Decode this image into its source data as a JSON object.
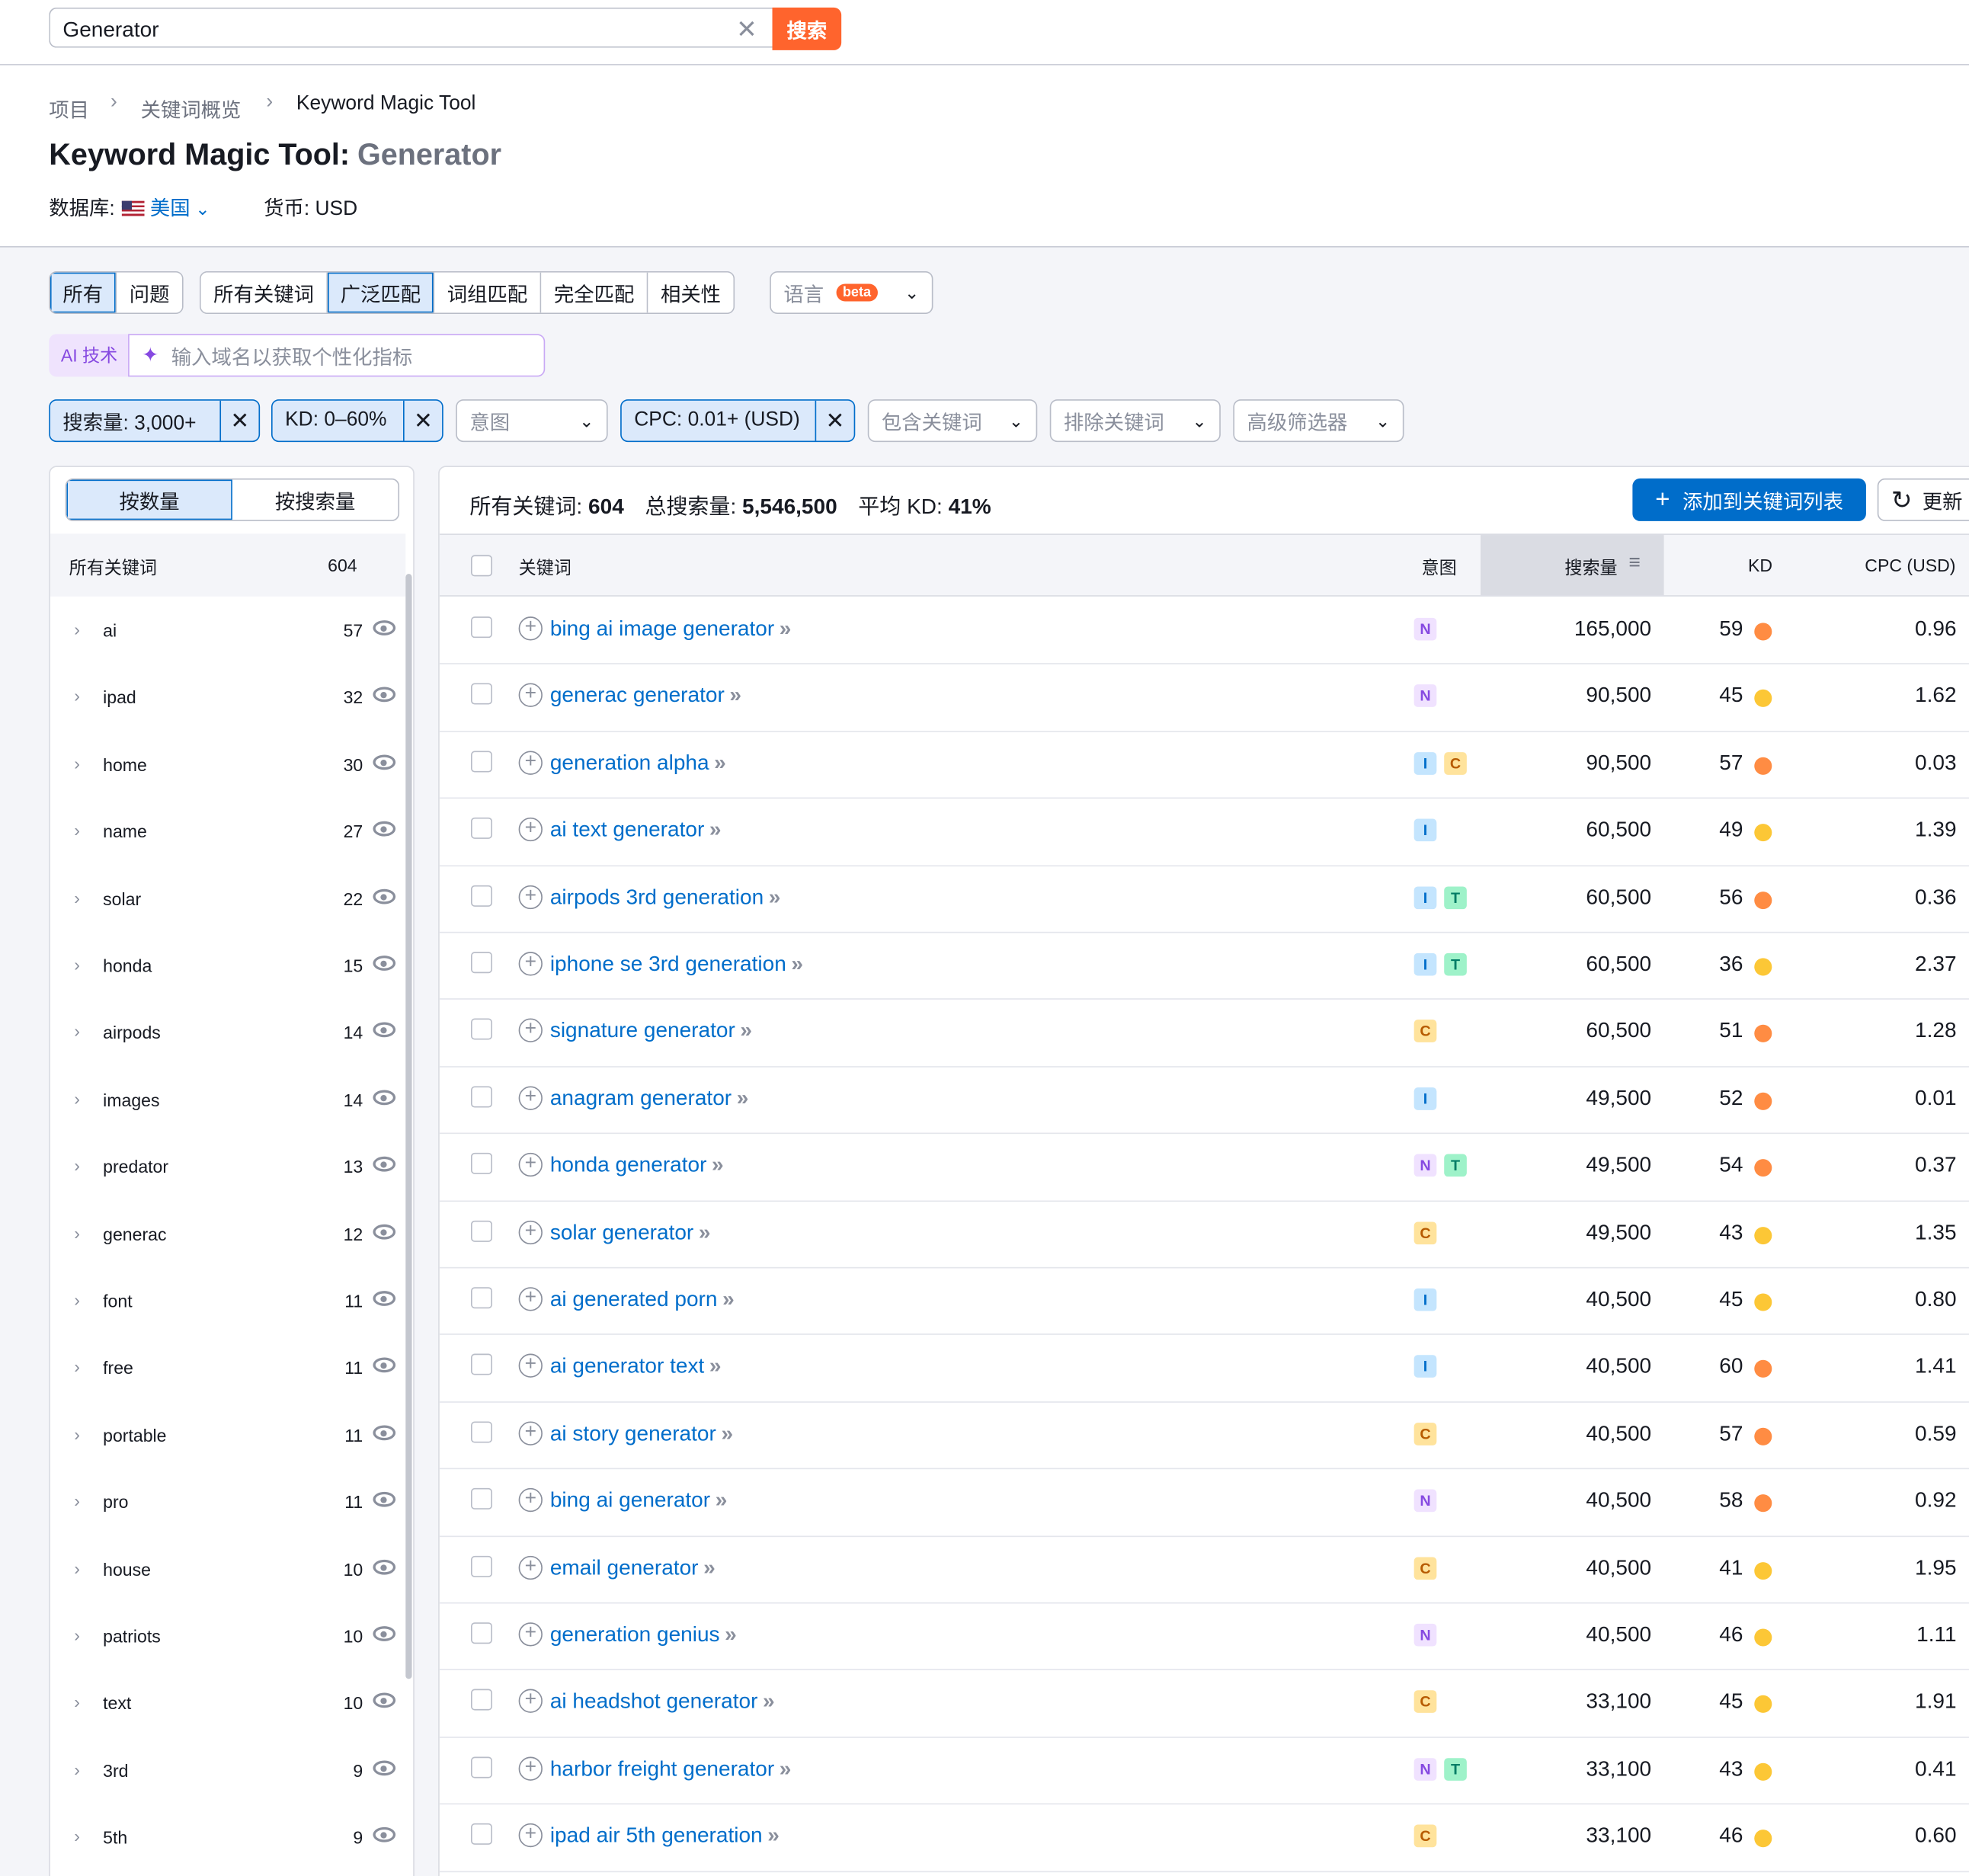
{
  "search": {
    "value": "Generator",
    "button": "搜索",
    "clear_icon": "close-icon"
  },
  "breadcrumb": [
    "项目",
    "关键词概览",
    "Keyword Magic Tool"
  ],
  "title": {
    "tool": "Keyword Magic Tool:",
    "seed": "Generator"
  },
  "database": {
    "label": "数据库:",
    "country": "美国",
    "currency_label": "货币: USD"
  },
  "tabs": {
    "group1": [
      "所有",
      "问题"
    ],
    "group2": [
      "所有关键词",
      "广泛匹配",
      "词组匹配",
      "完全匹配",
      "相关性"
    ],
    "language": "语言",
    "beta": "beta"
  },
  "ai": {
    "label": "AI 技术",
    "placeholder": "输入域名以获取个性化指标"
  },
  "filters": {
    "volume": "搜索量: 3,000+",
    "kd": "KD: 0–60%",
    "intent": "意图",
    "cpc": "CPC: 0.01+ (USD)",
    "include": "包含关键词",
    "exclude": "排除关键词",
    "advanced": "高级筛选器"
  },
  "groups_panel": {
    "toggle": [
      "按数量",
      "按搜索量"
    ],
    "header": {
      "name": "所有关键词",
      "count": "604"
    },
    "items": [
      {
        "name": "ai",
        "count": "57"
      },
      {
        "name": "ipad",
        "count": "32"
      },
      {
        "name": "home",
        "count": "30"
      },
      {
        "name": "name",
        "count": "27"
      },
      {
        "name": "solar",
        "count": "22"
      },
      {
        "name": "honda",
        "count": "15"
      },
      {
        "name": "airpods",
        "count": "14"
      },
      {
        "name": "images",
        "count": "14"
      },
      {
        "name": "predator",
        "count": "13"
      },
      {
        "name": "generac",
        "count": "12"
      },
      {
        "name": "font",
        "count": "11"
      },
      {
        "name": "free",
        "count": "11"
      },
      {
        "name": "portable",
        "count": "11"
      },
      {
        "name": "pro",
        "count": "11"
      },
      {
        "name": "house",
        "count": "10"
      },
      {
        "name": "patriots",
        "count": "10"
      },
      {
        "name": "text",
        "count": "10"
      },
      {
        "name": "3rd",
        "count": "9"
      },
      {
        "name": "5th",
        "count": "9"
      }
    ]
  },
  "summary": {
    "all_label": "所有关键词:",
    "all_value": "604",
    "volume_label": "总搜索量:",
    "volume_value": "5,546,500",
    "kd_label": "平均 KD:",
    "kd_value": "41%"
  },
  "actions": {
    "add": "添加到关键词列表",
    "update": "更新"
  },
  "columns": {
    "keyword": "关键词",
    "intent": "意图",
    "volume": "搜索量",
    "kd": "KD",
    "cpc": "CPC (USD)"
  },
  "colors": {
    "accent": "#006dca",
    "brand": "#ff642d",
    "kd_orange": "#ff8c43",
    "kd_yellow": "#fcc736"
  },
  "rows": [
    {
      "keyword": "bing ai image generator",
      "intents": [
        "N"
      ],
      "volume": "165,000",
      "kd": "59",
      "kd_color": "#ff8c43",
      "cpc": "0.96"
    },
    {
      "keyword": "generac generator",
      "intents": [
        "N"
      ],
      "volume": "90,500",
      "kd": "45",
      "kd_color": "#fcc736",
      "cpc": "1.62"
    },
    {
      "keyword": "generation alpha",
      "intents": [
        "I",
        "C"
      ],
      "volume": "90,500",
      "kd": "57",
      "kd_color": "#ff8c43",
      "cpc": "0.03"
    },
    {
      "keyword": "ai text generator",
      "intents": [
        "I"
      ],
      "volume": "60,500",
      "kd": "49",
      "kd_color": "#fcc736",
      "cpc": "1.39"
    },
    {
      "keyword": "airpods 3rd generation",
      "intents": [
        "I",
        "T"
      ],
      "volume": "60,500",
      "kd": "56",
      "kd_color": "#ff8c43",
      "cpc": "0.36"
    },
    {
      "keyword": "iphone se 3rd generation",
      "intents": [
        "I",
        "T"
      ],
      "volume": "60,500",
      "kd": "36",
      "kd_color": "#fcc736",
      "cpc": "2.37"
    },
    {
      "keyword": "signature generator",
      "intents": [
        "C"
      ],
      "volume": "60,500",
      "kd": "51",
      "kd_color": "#ff8c43",
      "cpc": "1.28"
    },
    {
      "keyword": "anagram generator",
      "intents": [
        "I"
      ],
      "volume": "49,500",
      "kd": "52",
      "kd_color": "#ff8c43",
      "cpc": "0.01"
    },
    {
      "keyword": "honda generator",
      "intents": [
        "N",
        "T"
      ],
      "volume": "49,500",
      "kd": "54",
      "kd_color": "#ff8c43",
      "cpc": "0.37"
    },
    {
      "keyword": "solar generator",
      "intents": [
        "C"
      ],
      "volume": "49,500",
      "kd": "43",
      "kd_color": "#fcc736",
      "cpc": "1.35"
    },
    {
      "keyword": "ai generated porn",
      "intents": [
        "I"
      ],
      "volume": "40,500",
      "kd": "45",
      "kd_color": "#fcc736",
      "cpc": "0.80"
    },
    {
      "keyword": "ai generator text",
      "intents": [
        "I"
      ],
      "volume": "40,500",
      "kd": "60",
      "kd_color": "#ff8c43",
      "cpc": "1.41"
    },
    {
      "keyword": "ai story generator",
      "intents": [
        "C"
      ],
      "volume": "40,500",
      "kd": "57",
      "kd_color": "#ff8c43",
      "cpc": "0.59"
    },
    {
      "keyword": "bing ai generator",
      "intents": [
        "N"
      ],
      "volume": "40,500",
      "kd": "58",
      "kd_color": "#ff8c43",
      "cpc": "0.92"
    },
    {
      "keyword": "email generator",
      "intents": [
        "C"
      ],
      "volume": "40,500",
      "kd": "41",
      "kd_color": "#fcc736",
      "cpc": "1.95"
    },
    {
      "keyword": "generation genius",
      "intents": [
        "N"
      ],
      "volume": "40,500",
      "kd": "46",
      "kd_color": "#fcc736",
      "cpc": "1.11"
    },
    {
      "keyword": "ai headshot generator",
      "intents": [
        "C"
      ],
      "volume": "33,100",
      "kd": "45",
      "kd_color": "#fcc736",
      "cpc": "1.91"
    },
    {
      "keyword": "harbor freight generator",
      "intents": [
        "N",
        "T"
      ],
      "volume": "33,100",
      "kd": "43",
      "kd_color": "#fcc736",
      "cpc": "0.41"
    },
    {
      "keyword": "ipad air 5th generation",
      "intents": [
        "C"
      ],
      "volume": "33,100",
      "kd": "46",
      "kd_color": "#fcc736",
      "cpc": "0.60"
    }
  ]
}
